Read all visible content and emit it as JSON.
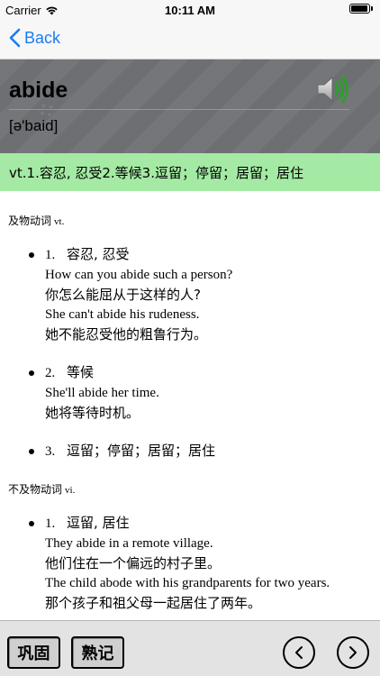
{
  "status_bar": {
    "carrier": "Carrier",
    "time": "10:11 AM",
    "battery_level": 0.95
  },
  "nav": {
    "back_label": "Back"
  },
  "word": {
    "headword": "abide",
    "phonetic": "[ə'baid]",
    "summary": "vt.1.容忍, 忍受2.等候3.逗留；停留；居留；居住"
  },
  "sections": [
    {
      "pos_cn": "及物动词",
      "pos_abbr": "vt.",
      "senses": [
        {
          "num": "1.",
          "meaning": "容忍, 忍受",
          "examples": [
            "How can you abide such a person?",
            "你怎么能屈从于这样的人?",
            "She can't abide his rudeness.",
            "她不能忍受他的粗鲁行为。"
          ]
        },
        {
          "num": "2.",
          "meaning": "等候",
          "examples": [
            "She'll abide her time.",
            "她将等待时机。"
          ]
        },
        {
          "num": "3.",
          "meaning": "逗留；停留；居留；居住",
          "examples": []
        }
      ]
    },
    {
      "pos_cn": "不及物动词",
      "pos_abbr": "vi.",
      "senses": [
        {
          "num": "1.",
          "meaning": "逗留, 居住",
          "examples": [
            "They abide in a remote village.",
            "他们住在一个偏远的村子里。",
            "The child abode with his grandparents for two years.",
            "那个孩子和祖父母一起居住了两年。"
          ]
        }
      ]
    }
  ],
  "toolbar": {
    "consolidate_label": "巩固",
    "memorized_label": "熟记"
  },
  "icons": {
    "back": "chevron-left-icon",
    "speaker": "speaker-icon",
    "prev": "chevron-left-circle-icon",
    "next": "chevron-right-circle-icon"
  },
  "colors": {
    "accent": "#1a7cf5",
    "summary_bg": "#a4eaa4",
    "header_bg": "#6e6f73"
  }
}
